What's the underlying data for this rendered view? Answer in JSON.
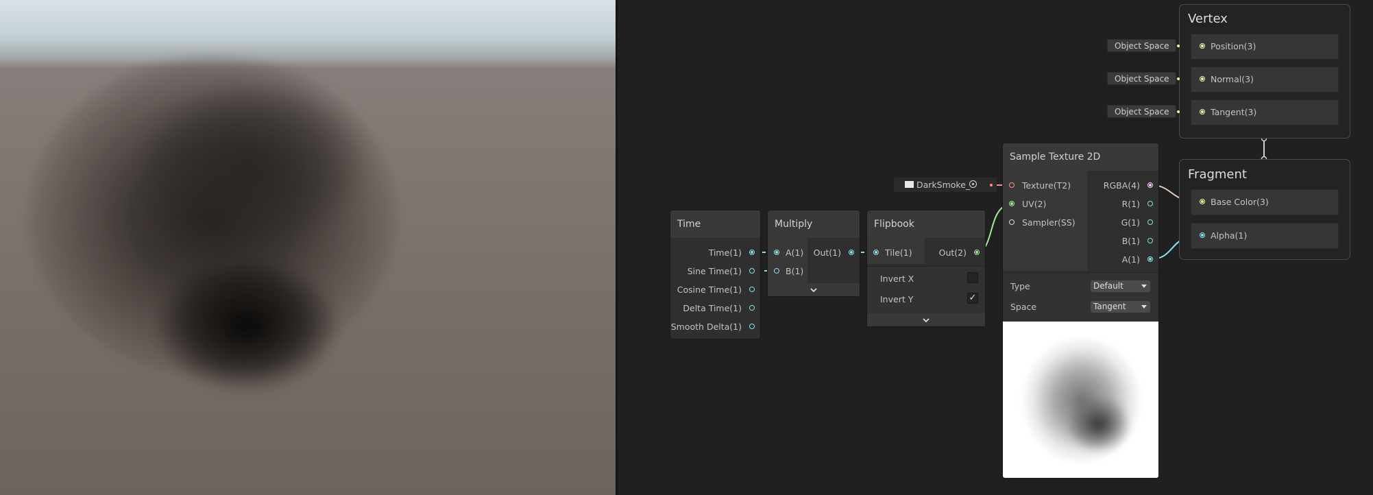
{
  "nodes": {
    "time": {
      "title": "Time",
      "outputs": [
        "Time(1)",
        "Sine Time(1)",
        "Cosine Time(1)",
        "Delta Time(1)",
        "Smooth Delta(1)"
      ]
    },
    "multiply": {
      "title": "Multiply",
      "inputs": [
        "A(1)",
        "B(1)"
      ],
      "output": "Out(1)"
    },
    "flipbook": {
      "title": "Flipbook",
      "input": "Tile(1)",
      "output": "Out(2)",
      "invert_x_label": "Invert X",
      "invert_x": false,
      "invert_y_label": "Invert Y",
      "invert_y": true,
      "check_mark": "✓"
    },
    "sample_texture": {
      "title": "Sample Texture 2D",
      "inputs": [
        "Texture(T2)",
        "UV(2)",
        "Sampler(SS)"
      ],
      "outputs": [
        "RGBA(4)",
        "R(1)",
        "G(1)",
        "B(1)",
        "A(1)"
      ],
      "type_label": "Type",
      "type_value": "Default",
      "space_label": "Space",
      "space_value": "Tangent",
      "texture_asset": "DarkSmoke_"
    },
    "vertex": {
      "title": "Vertex",
      "blocks": [
        "Position(3)",
        "Normal(3)",
        "Tangent(3)"
      ],
      "space_chips": [
        "Object Space",
        "Object Space",
        "Object Space"
      ]
    },
    "fragment": {
      "title": "Fragment",
      "blocks": [
        "Base Color(3)",
        "Alpha(1)"
      ]
    }
  },
  "colors": {
    "float_port": "#84e4e7",
    "vector2_port": "#9cf08f",
    "vector3_port": "#f7f7a0",
    "vector4_port": "#fbcbf4",
    "texture_port": "#ff8d8d",
    "canvas": "#202020"
  },
  "icons": {
    "collapse": "chevron-down-icon",
    "object_picker": "target-icon"
  }
}
